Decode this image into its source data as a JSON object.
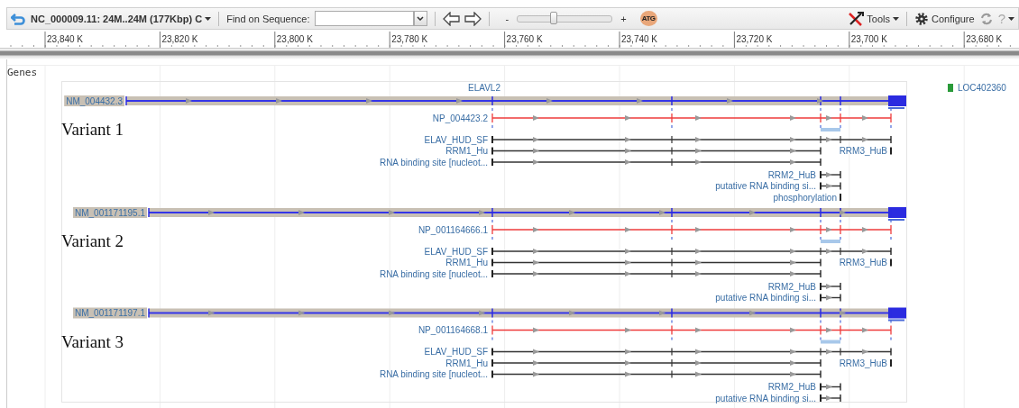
{
  "toolbar": {
    "sequence": "NC_000009.11: 24M..24M (177Kbp) C",
    "find_label": "Find on Sequence:",
    "zoom_out": "-",
    "zoom": {
      "level": 0.38
    },
    "zoom_in": "+",
    "sequence_button": "ATG",
    "tools": "Tools",
    "configure": "Configure",
    "help": "?"
  },
  "ruler": [
    "23,840 K",
    "23,820 K",
    "23,800 K",
    "23,780 K",
    "23,760 K",
    "23,740 K",
    "23,720 K",
    "23,700 K",
    "23,680 K"
  ],
  "track": {
    "title": "Genes",
    "gene": "ELAVL2",
    "neighbor_gene": "LOC402360",
    "variants": [
      {
        "caption": "Variant 1",
        "transcript": "NM_004432.3",
        "protein": "NP_004423.2",
        "features": [
          {
            "label": "ELAV_HUD_SF",
            "kind": "span"
          },
          {
            "label": "RRM1_Hu",
            "kind": "head"
          },
          {
            "label": "RRM3_HuB",
            "kind": "tail"
          },
          {
            "label": "RNA binding site [nucleot...",
            "kind": "head"
          },
          {
            "label": "RRM2_HuB",
            "kind": "short"
          },
          {
            "label": "putative RNA binding si...",
            "kind": "short"
          },
          {
            "label": "phosphorylation",
            "kind": "point"
          }
        ]
      },
      {
        "caption": "Variant 2",
        "transcript": "NM_001171195.1",
        "protein": "NP_001164666.1",
        "features": [
          {
            "label": "ELAV_HUD_SF",
            "kind": "span"
          },
          {
            "label": "RRM1_Hu",
            "kind": "head"
          },
          {
            "label": "RRM3_HuB",
            "kind": "tail"
          },
          {
            "label": "RNA binding site [nucleot...",
            "kind": "head"
          },
          {
            "label": "RRM2_HuB",
            "kind": "short"
          },
          {
            "label": "putative RNA binding si...",
            "kind": "short"
          }
        ]
      },
      {
        "caption": "Variant 3",
        "transcript": "NM_001171197.1",
        "protein": "NP_001164668.1",
        "features": [
          {
            "label": "ELAV_HUD_SF",
            "kind": "span"
          },
          {
            "label": "RRM1_Hu",
            "kind": "head"
          },
          {
            "label": "RRM3_HuB",
            "kind": "tail"
          },
          {
            "label": "RNA binding site [nucleot...",
            "kind": "head"
          },
          {
            "label": "RRM2_HuB",
            "kind": "short"
          },
          {
            "label": "putative RNA binding si...",
            "kind": "short"
          }
        ]
      }
    ]
  }
}
